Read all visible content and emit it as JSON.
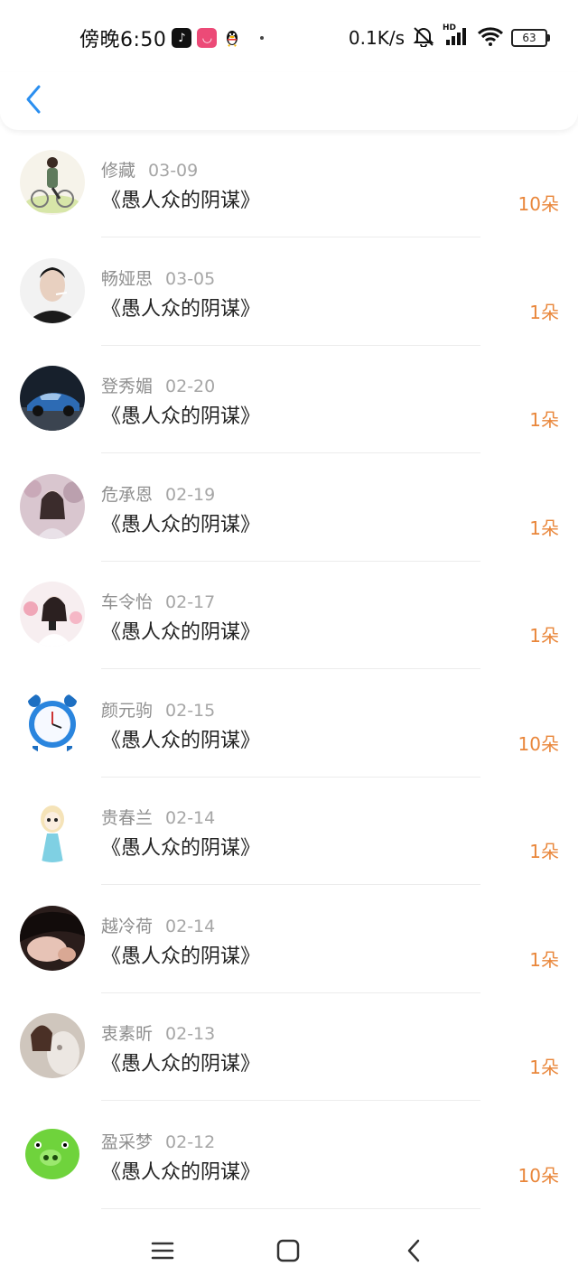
{
  "status_bar": {
    "time": "傍晚6:50",
    "net_speed": "0.1K/s",
    "battery": "63",
    "hd_label": "HD"
  },
  "colors": {
    "accent_blue": "#2b8ff0",
    "flower_orange": "#e9863a"
  },
  "entries": [
    {
      "name": "修藏",
      "date": "03-09",
      "title": "《愚人众的阴谋》",
      "flowers": "10朵",
      "avatar": "avatar-bicycle-boy"
    },
    {
      "name": "畅娅思",
      "date": "03-05",
      "title": "《愚人众的阴谋》",
      "flowers": "1朵",
      "avatar": "avatar-smoking-man"
    },
    {
      "name": "登秀媚",
      "date": "02-20",
      "title": "《愚人众的阴谋》",
      "flowers": "1朵",
      "avatar": "avatar-blue-car"
    },
    {
      "name": "危承恩",
      "date": "02-19",
      "title": "《愚人众的阴谋》",
      "flowers": "1朵",
      "avatar": "avatar-girl-blossoms"
    },
    {
      "name": "车令怡",
      "date": "02-17",
      "title": "《愚人众的阴谋》",
      "flowers": "1朵",
      "avatar": "avatar-girl-white"
    },
    {
      "name": "颜元驹",
      "date": "02-15",
      "title": "《愚人众的阴谋》",
      "flowers": "10朵",
      "avatar": "avatar-alarm-clock"
    },
    {
      "name": "贵春兰",
      "date": "02-14",
      "title": "《愚人众的阴谋》",
      "flowers": "1朵",
      "avatar": "avatar-cartoon-princess"
    },
    {
      "name": "越冷荷",
      "date": "02-14",
      "title": "《愚人众的阴谋》",
      "flowers": "1朵",
      "avatar": "avatar-dark-portrait"
    },
    {
      "name": "衷素昕",
      "date": "02-13",
      "title": "《愚人众的阴谋》",
      "flowers": "1朵",
      "avatar": "avatar-girl-statue"
    },
    {
      "name": "盈采梦",
      "date": "02-12",
      "title": "《愚人众的阴谋》",
      "flowers": "10朵",
      "avatar": "avatar-green-pig"
    }
  ]
}
